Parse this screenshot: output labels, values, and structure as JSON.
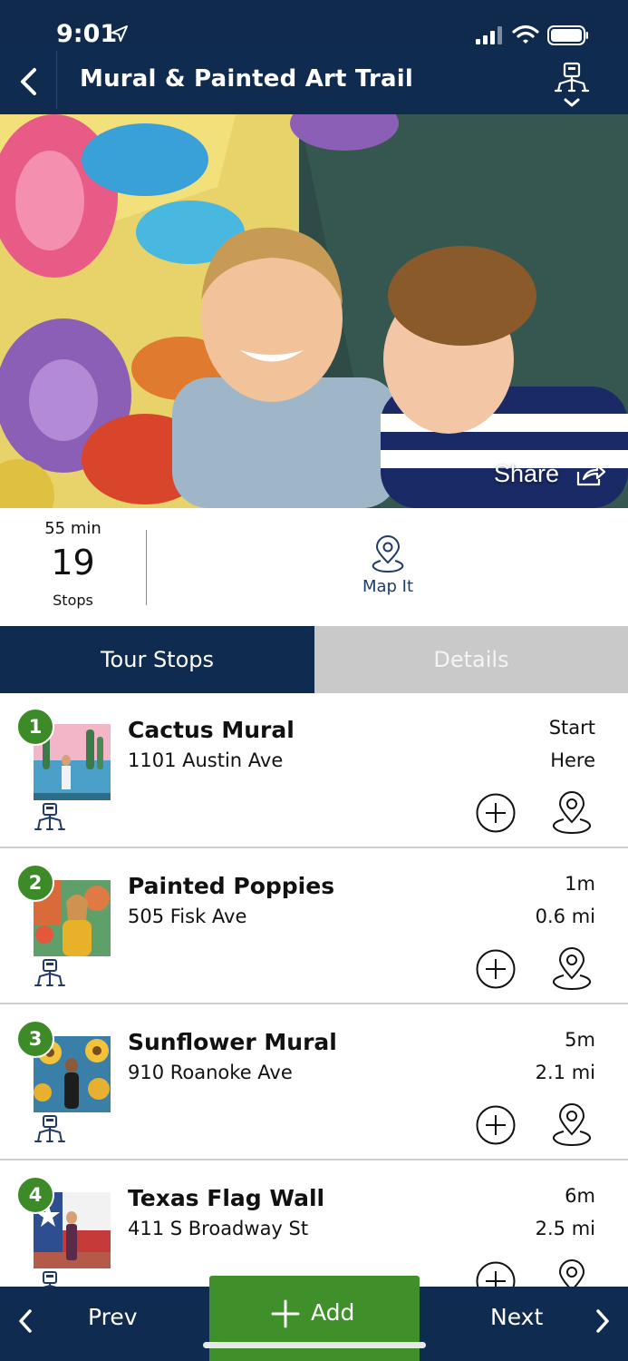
{
  "status_bar": {
    "time": "9:01"
  },
  "nav": {
    "title": "Mural & Painted Art Trail"
  },
  "hero": {
    "share_label": "Share"
  },
  "stats": {
    "duration": "55 min",
    "stops_count": "19",
    "stops_label": "Stops",
    "map_it_label": "Map It"
  },
  "tabs": [
    {
      "label": "Tour Stops",
      "active": true
    },
    {
      "label": "Details",
      "active": false
    }
  ],
  "stops": [
    {
      "number": "1",
      "name": "Cactus Mural",
      "address": "1101 Austin Ave",
      "meta1": "Start",
      "meta2": "Here"
    },
    {
      "number": "2",
      "name": "Painted Poppies",
      "address": "505 Fisk Ave",
      "meta1": "1m",
      "meta2": "0.6 mi"
    },
    {
      "number": "3",
      "name": "Sunflower Mural",
      "address": "910 Roanoke Ave",
      "meta1": "5m",
      "meta2": "2.1 mi"
    },
    {
      "number": "4",
      "name": "Texas Flag Wall",
      "address": "411 S Broadway St",
      "meta1": "6m",
      "meta2": "2.5 mi"
    }
  ],
  "bottom": {
    "prev_label": "Prev",
    "add_label": "Add",
    "next_label": "Next"
  },
  "colors": {
    "navy": "#102b50",
    "green": "#3d8a28",
    "tab_inactive": "#c9c9c9"
  }
}
